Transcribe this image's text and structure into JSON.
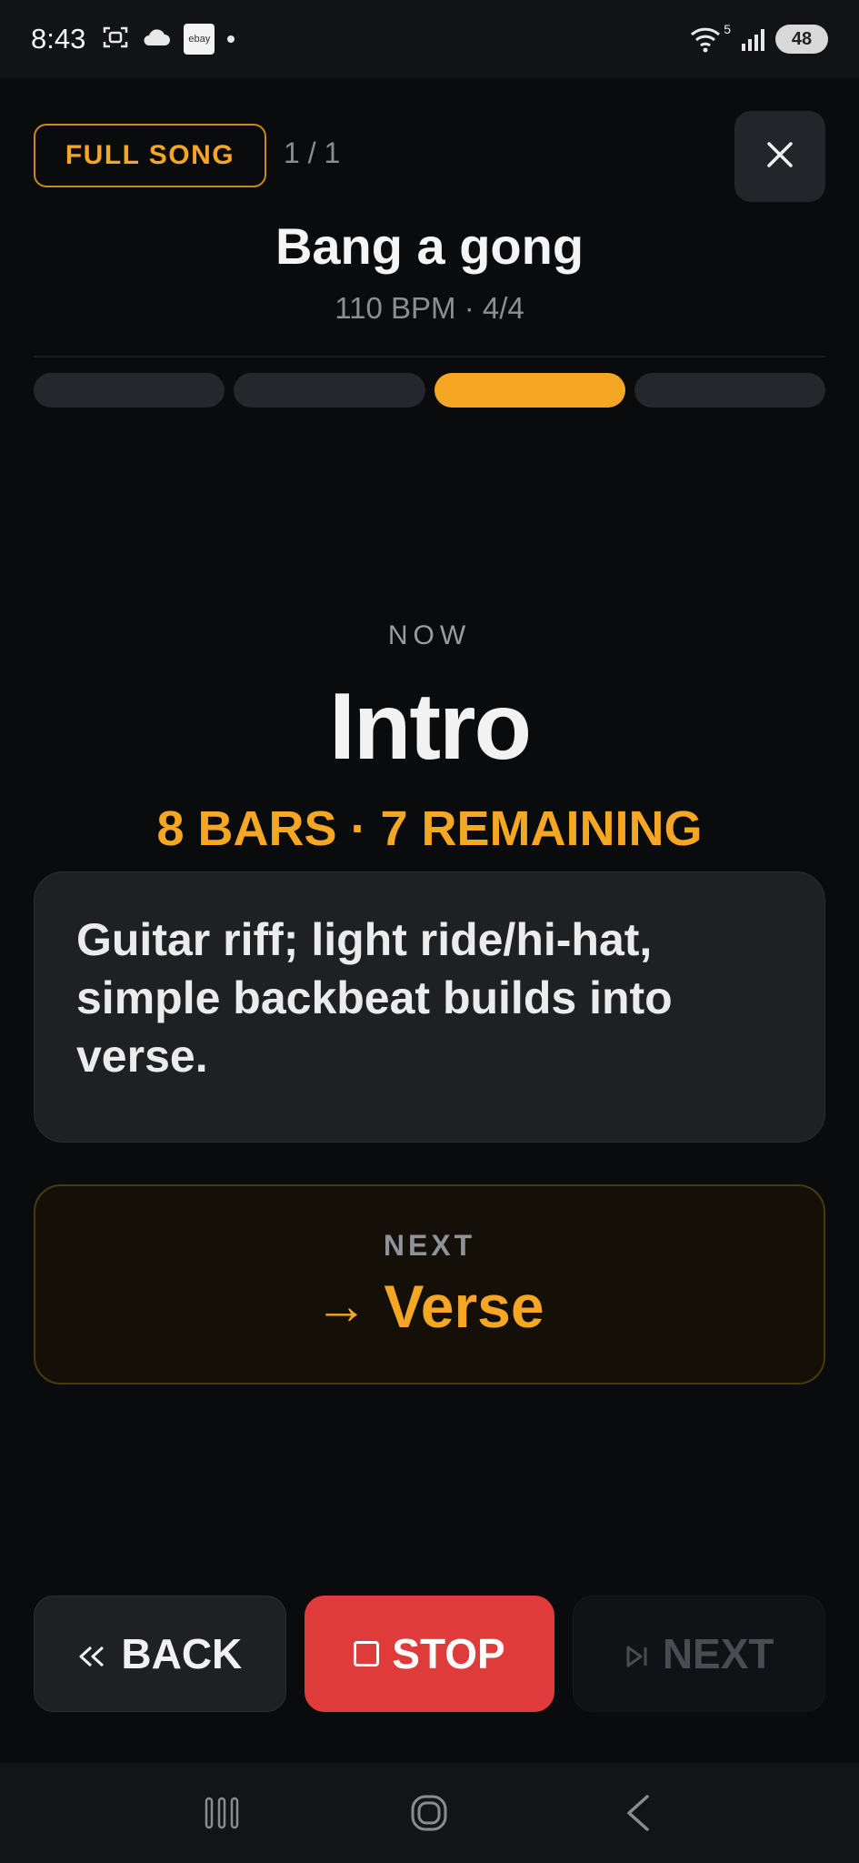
{
  "status_bar": {
    "time": "8:43",
    "ebay_badge": "ebay",
    "wifi_superscript": "5",
    "battery": "48",
    "icons": [
      "screenshot-icon",
      "cloud-icon",
      "ebay-icon",
      "dot-icon",
      "wifi-icon",
      "signal-icon",
      "battery-icon"
    ]
  },
  "header": {
    "mode_badge": "FULL SONG",
    "song_counter": "1 / 1",
    "close_icon": "close-icon",
    "song_title": "Bang a gong",
    "song_meta": "110 BPM · 4/4"
  },
  "progress": {
    "segments": 4,
    "active_index": 2,
    "accent_color": "#f5a623"
  },
  "now": {
    "label": "NOW",
    "section_name": "Intro",
    "bars_info": "8 BARS · 7 REMAINING",
    "note": "Guitar riff; light ride/hi-hat, simple backbeat builds into verse."
  },
  "next": {
    "label": "NEXT",
    "arrow": "→",
    "section_name": "Verse"
  },
  "controls": {
    "back_label": "BACK",
    "stop_label": "STOP",
    "next_label": "NEXT",
    "stop_color": "#e03b3b"
  },
  "nav_bar": {
    "icons": [
      "recent-apps-icon",
      "home-icon",
      "back-nav-icon"
    ]
  }
}
